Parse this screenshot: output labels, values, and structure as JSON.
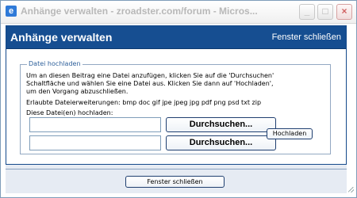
{
  "window": {
    "title": "Anhänge verwalten - zroadster.com/forum - Micros...",
    "icon": "ie-icon",
    "controls": {
      "minimize": "minimize-icon",
      "maximize": "maximize-icon",
      "close": "close-icon"
    }
  },
  "dialog": {
    "title": "Anhänge verwalten",
    "header_close_link": "Fenster schließen",
    "upload_group": {
      "legend": "Datei hochladen",
      "instructions": [
        "Um an diesen Beitrag eine Datei anzufügen, klicken Sie auf die 'Durchsuchen'",
        "Schaltfläche und wählen Sie eine Datei aus. Klicken Sie dann auf 'Hochladen',",
        "um den Vorgang abzuschließen."
      ],
      "allowed_extensions": "Erlaubte Dateierweiterungen: bmp doc gif jpe jpeg jpg pdf png psd txt zip",
      "files_label": "Diese Datei(en) hochladen:",
      "rows": [
        {
          "value": "",
          "browse_label": "Durchsuchen..."
        },
        {
          "value": "",
          "browse_label": "Durchsuchen..."
        }
      ],
      "upload_label": "Hochladen"
    },
    "footer_close_button": "Fenster schließen"
  },
  "colors": {
    "header_blue": "#164e91",
    "border_blue": "#14498b",
    "legend_blue": "#2d5f9a"
  }
}
